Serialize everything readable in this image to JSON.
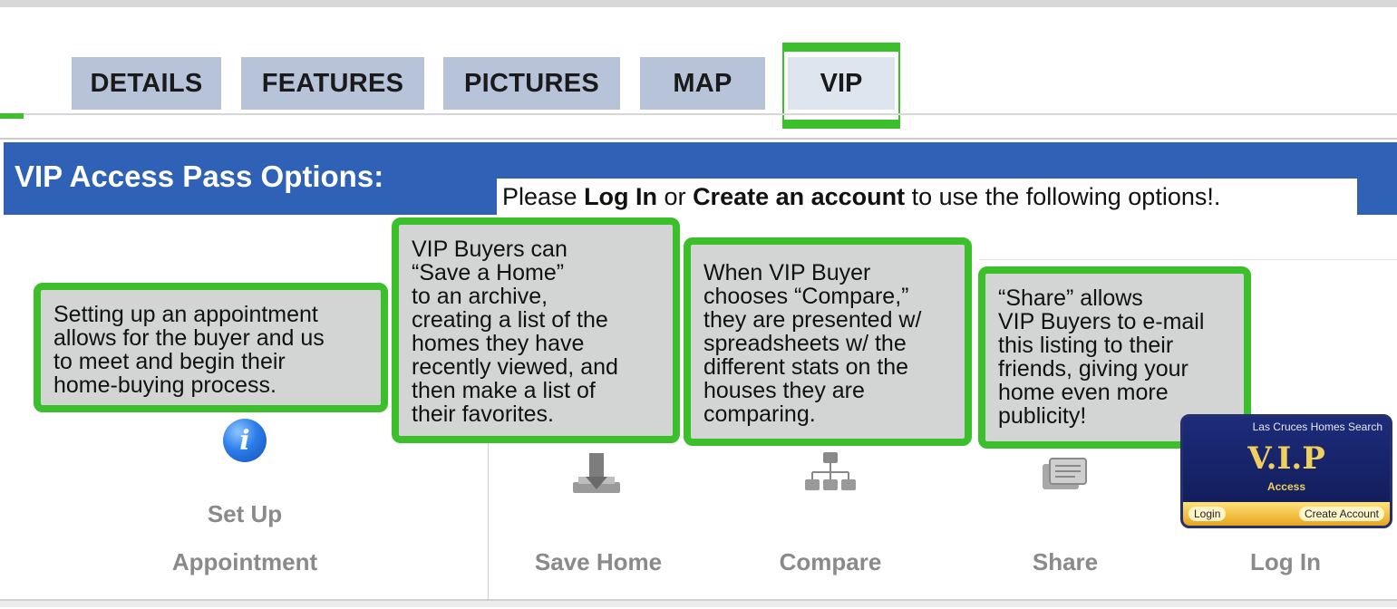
{
  "tabs": [
    {
      "label": "DETAILS"
    },
    {
      "label": "FEATURES"
    },
    {
      "label": "PICTURES"
    },
    {
      "label": "MAP"
    },
    {
      "label": "VIP",
      "active": true
    }
  ],
  "vip": {
    "heading": "VIP Access Pass Options:",
    "notice": {
      "prefix": "Please ",
      "login_link": "Log In",
      "middle": " or ",
      "create_link": "Create an account",
      "suffix": " to use the following options!."
    }
  },
  "callouts": {
    "appointment": "Setting up an appointment\nallows for the buyer and us\nto meet and begin their\nhome-buying process.",
    "save": "VIP Buyers can\n“Save a Home”\nto an archive,\ncreating a list of the\nhomes they have\nrecently viewed, and\nthen make a list of\ntheir favorites.",
    "compare": "When VIP Buyer\nchooses “Compare,”\nthey are presented w/\nspreadsheets w/ the\ndifferent stats on the\nhouses they are\ncomparing.",
    "share": "“Share” allows\nVIP Buyers to e-mail\nthis listing to their\nfriends, giving your\nhome even more\npublicity!"
  },
  "options": {
    "setup_line1": "Set Up",
    "setup_line2": "Appointment",
    "save_home": "Save Home",
    "compare": "Compare",
    "share": "Share",
    "login": "Log In"
  },
  "badge": {
    "top": "Las Cruces Homes Search",
    "title": "V.I.P",
    "subtitle": "Access",
    "login": "Login",
    "create": "Create Account"
  },
  "colors": {
    "accent_green": "#3bbf2b",
    "header_blue": "#2f62b6",
    "tab_bg": "#b6c3d9"
  },
  "icons": [
    "info-icon",
    "save-home-icon",
    "compare-icon",
    "share-icon",
    "vip-badge-icon"
  ]
}
